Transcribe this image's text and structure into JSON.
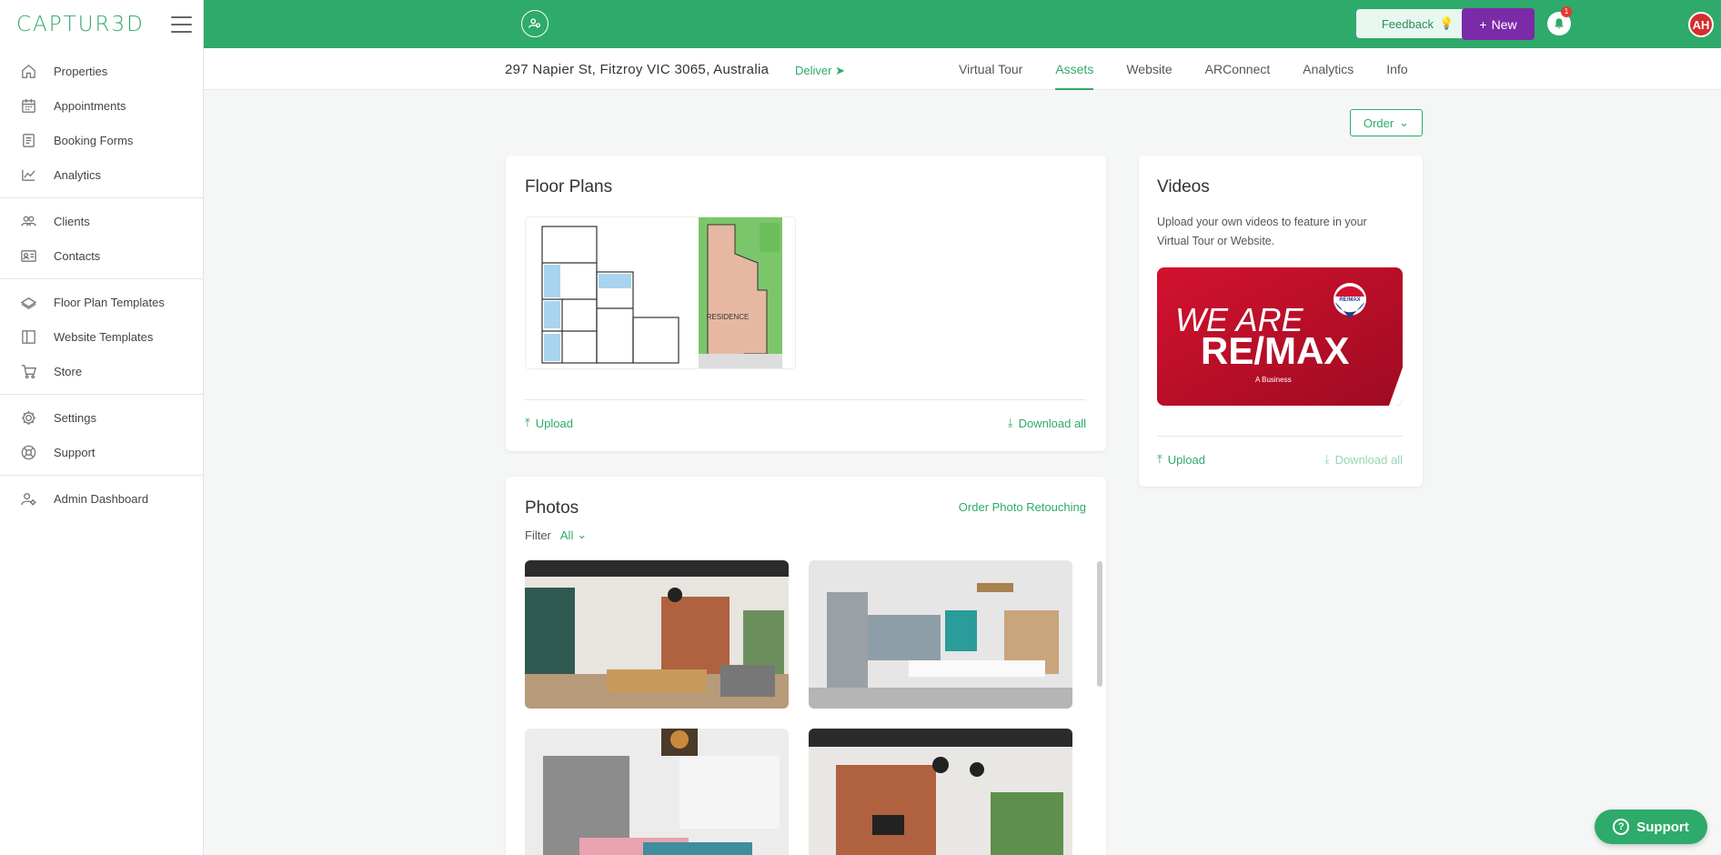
{
  "brand": {
    "logo": "CAPTUR3D"
  },
  "sidebar": {
    "groups": [
      [
        {
          "label": "Properties",
          "icon": "home-icon"
        },
        {
          "label": "Appointments",
          "icon": "calendar-icon"
        },
        {
          "label": "Booking Forms",
          "icon": "form-icon"
        },
        {
          "label": "Analytics",
          "icon": "chart-icon"
        }
      ],
      [
        {
          "label": "Clients",
          "icon": "clients-icon"
        },
        {
          "label": "Contacts",
          "icon": "contact-card-icon"
        }
      ],
      [
        {
          "label": "Floor Plan Templates",
          "icon": "layers-icon"
        },
        {
          "label": "Website Templates",
          "icon": "layout-icon"
        },
        {
          "label": "Store",
          "icon": "cart-icon"
        }
      ],
      [
        {
          "label": "Settings",
          "icon": "gear-icon"
        },
        {
          "label": "Support",
          "icon": "lifebuoy-icon"
        }
      ],
      [
        {
          "label": "Admin Dashboard",
          "icon": "admin-icon"
        }
      ]
    ]
  },
  "topbar": {
    "feedback_label": "Feedback",
    "new_label": "New",
    "notification_count": "1",
    "avatar_initials": "AH",
    "accent_color": "#2eaa6a",
    "new_color": "#7b2aa8"
  },
  "subheader": {
    "address": "297 Napier St, Fitzroy VIC 3065, Australia",
    "deliver_label": "Deliver",
    "tabs": [
      "Virtual Tour",
      "Assets",
      "Website",
      "ARConnect",
      "Analytics",
      "Info"
    ],
    "active_tab": "Assets"
  },
  "order_label": "Order",
  "floor_plans": {
    "title": "Floor Plans",
    "upload_label": "Upload",
    "download_label": "Download all",
    "plan_label": "RESIDENCE"
  },
  "videos": {
    "title": "Videos",
    "description": "Upload your own videos to feature in your Virtual Tour or Website.",
    "video_line1": "WE ARE",
    "video_line2": "RE/MAX",
    "video_sub": "A Business",
    "video_badge": "RE/MAX",
    "upload_label": "Upload",
    "download_label": "Download all"
  },
  "photos": {
    "title": "Photos",
    "retouch_label": "Order Photo Retouching",
    "filter_label": "Filter",
    "filter_value": "All"
  },
  "support_label": "Support"
}
